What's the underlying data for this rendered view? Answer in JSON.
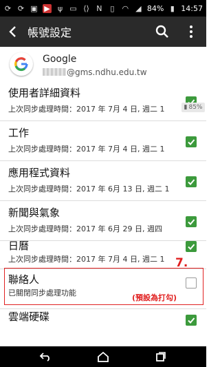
{
  "status_bar": {
    "battery": "84%",
    "time": "14:57",
    "left_icons": [
      "sync-icon",
      "sync-icon",
      "photo-icon",
      "app-icon",
      "usb-icon",
      "ip-icon",
      "code-icon"
    ],
    "right_icons": [
      "nfc-icon",
      "vibrate-icon",
      "wifi-icon",
      "signal-icon",
      "battery-icon"
    ]
  },
  "app_bar": {
    "title": "帳號設定"
  },
  "account": {
    "name": "Google",
    "email_suffix": "@gms.ndhu.edu.tw"
  },
  "battery_badge": "85%",
  "sync_items": [
    {
      "name": "使用者詳細資料",
      "status": "上次同步處理時間：2017 年 7月 4 日, 週二 1",
      "checked": true
    },
    {
      "name": "工作",
      "status": "上次同步處理時間：2017 年 7月 4 日, 週二 1",
      "checked": true
    },
    {
      "name": "應用程式資料",
      "status": "上次同步處理時間：2017 年 6月 13 日, 週二 1",
      "checked": true
    },
    {
      "name": "新聞與氣象",
      "status": "上次同步處理時間：2017 年 6月 29 日, 週四",
      "checked": true
    },
    {
      "name": "日曆",
      "status": "上次同步處理時間：2017 年 7月 4 日, 週二 1",
      "checked": true
    },
    {
      "name": "聯絡人",
      "status": "已關閉同步處理功能",
      "checked": false
    },
    {
      "name": "雲端硬碟",
      "status": "",
      "checked": true
    }
  ],
  "annotation": {
    "step": "7.",
    "note": "(預設為打勾)",
    "color": "#e02020"
  },
  "accent_color": "#3c9a3c"
}
